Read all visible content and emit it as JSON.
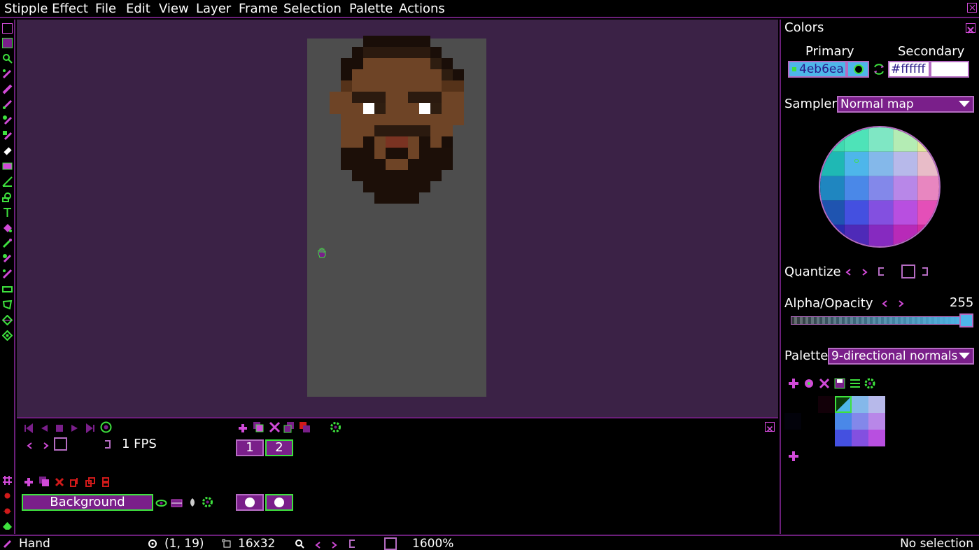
{
  "menubar": {
    "items": [
      "Stipple Effect",
      "File",
      "Edit",
      "View",
      "Layer",
      "Frame",
      "Selection",
      "Palette",
      "Actions"
    ]
  },
  "toolbar": {
    "tools": [
      "hand-icon",
      "zoom-icon",
      "eyedropper-icon",
      "pencil-icon",
      "brush-icon",
      "shade-brush-icon",
      "script-brush-icon",
      "eraser-icon",
      "stipple-icon",
      "line-icon",
      "shape-icon",
      "text-icon",
      "fill-icon",
      "gradient-icon",
      "color-picker-icon",
      "brush-2-icon",
      "box-select-icon",
      "lasso-icon",
      "wand-icon",
      "move-icon"
    ],
    "bottom": [
      "grid-icon",
      "bug-icon",
      "bug-2-icon",
      "spade-icon"
    ]
  },
  "timeline": {
    "fps": "1 FPS",
    "frames": [
      "1",
      "2"
    ],
    "layer_name": "Background"
  },
  "colors": {
    "title": "Colors",
    "primary_label": "Primary",
    "secondary_label": "Secondary",
    "primary_hex": "4eb6ea",
    "secondary_hex": "#ffffff",
    "primary_color": "#4eb6ea",
    "secondary_color": "#ffffff",
    "sampler_label": "Sampler",
    "sampler_value": "Normal map",
    "quantize_label": "Quantize",
    "alpha_label": "Alpha/Opacity",
    "alpha_value": "255",
    "palette_label": "Palette",
    "palette_value": "9-directional normals"
  },
  "status": {
    "tool": "Hand",
    "cursor": "(1, 19)",
    "size": "16x32",
    "zoom": "1600%",
    "selection": "No selection"
  },
  "accent": "#3ee23e",
  "brand": "#7a1f8a"
}
